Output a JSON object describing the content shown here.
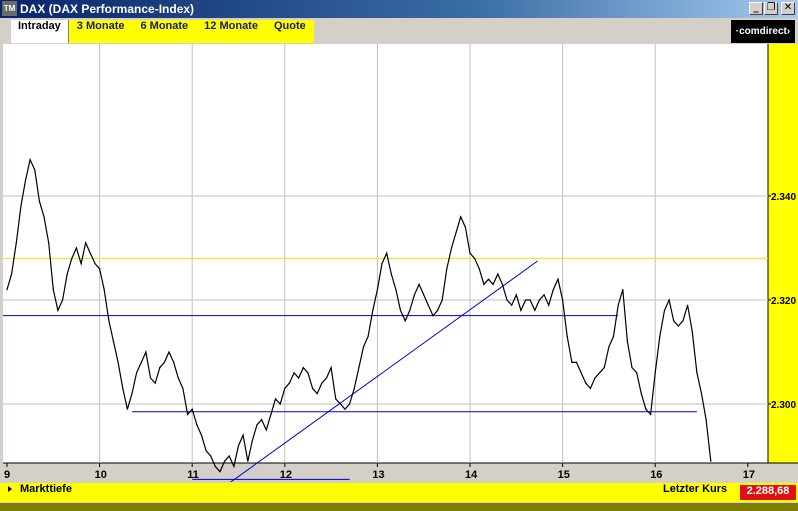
{
  "window": {
    "title": "DAX (DAX Performance-Index)",
    "app_icon_text": "TM",
    "buttons": [
      "_",
      "❐",
      "✕"
    ]
  },
  "tabs": [
    {
      "label": "Intraday",
      "active": true
    },
    {
      "label": "3 Monate",
      "active": false
    },
    {
      "label": "6 Monate",
      "active": false
    },
    {
      "label": "12 Monate",
      "active": false
    },
    {
      "label": "Quote",
      "active": false
    }
  ],
  "logo": "·comdirect›",
  "footer": {
    "left_label": "Markttiefe",
    "last_label": "Letzter Kurs",
    "last_value": "2.288,68"
  },
  "colors": {
    "price_line": "#000000",
    "trend_lines": "#0000cc",
    "yellow_level": "#e8e800",
    "grid": "#c0c0c0",
    "plot_bg": "#ffffff",
    "right_axis_bg": "#ffff00",
    "last_value_bg": "#e01010"
  },
  "chart_data": {
    "type": "line",
    "x_ticks": [
      "9",
      "10",
      "11",
      "12",
      "13",
      "14",
      "15",
      "16",
      "17"
    ],
    "y_ticks": [
      "2.300",
      "2.320",
      "2.340"
    ],
    "xlim": [
      9,
      17.2
    ],
    "ylim": [
      2283,
      2360
    ],
    "grid": true,
    "series": [
      {
        "x": [
          9.0,
          9.05,
          9.1,
          9.15,
          9.2,
          9.25,
          9.3,
          9.35,
          9.4,
          9.45,
          9.5,
          9.55,
          9.6,
          9.65,
          9.7,
          9.75,
          9.8,
          9.85,
          9.9,
          9.95,
          10.0,
          10.05,
          10.1,
          10.15,
          10.2,
          10.25,
          10.3,
          10.35,
          10.4,
          10.45,
          10.5,
          10.55,
          10.6,
          10.65,
          10.7,
          10.75,
          10.8,
          10.85,
          10.9,
          10.95,
          11.0,
          11.05,
          11.1,
          11.15,
          11.2,
          11.25,
          11.3,
          11.35,
          11.4,
          11.45,
          11.5,
          11.55,
          11.6,
          11.65,
          11.7,
          11.75,
          11.8,
          11.85,
          11.9,
          11.95,
          12.0,
          12.05,
          12.1,
          12.15,
          12.2,
          12.25,
          12.3,
          12.35,
          12.4,
          12.45,
          12.5,
          12.55,
          12.6,
          12.65,
          12.7,
          12.75,
          12.8,
          12.85,
          12.9,
          12.95,
          13.0,
          13.05,
          13.1,
          13.15,
          13.2,
          13.25,
          13.3,
          13.35,
          13.4,
          13.45,
          13.5,
          13.55,
          13.6,
          13.65,
          13.7,
          13.75,
          13.8,
          13.85,
          13.9,
          13.95,
          14.0,
          14.05,
          14.1,
          14.15,
          14.2,
          14.25,
          14.3,
          14.35,
          14.4,
          14.45,
          14.5,
          14.55,
          14.6,
          14.65,
          14.7,
          14.75,
          14.8,
          14.85,
          14.9,
          14.95,
          15.0,
          15.05,
          15.1,
          15.15,
          15.2,
          15.25,
          15.3,
          15.35,
          15.4,
          15.45,
          15.5,
          15.55,
          15.6,
          15.65,
          15.7,
          15.75,
          15.8,
          15.85,
          15.9,
          15.95,
          16.0,
          16.05,
          16.1,
          16.15,
          16.2,
          16.25,
          16.3,
          16.35,
          16.4,
          16.45,
          16.5,
          16.55,
          16.6
        ],
        "y": [
          2322,
          2325,
          2331,
          2338,
          2343,
          2347,
          2345,
          2339,
          2336,
          2331,
          2322,
          2318,
          2320,
          2325,
          2328,
          2330,
          2327,
          2331,
          2329,
          2327,
          2326,
          2322,
          2316,
          2312,
          2308,
          2303,
          2299,
          2302,
          2306,
          2308,
          2310,
          2305,
          2304,
          2307,
          2308,
          2310,
          2308,
          2305,
          2303,
          2298,
          2299,
          2296,
          2294,
          2291,
          2290,
          2288,
          2287,
          2289,
          2290,
          2288,
          2292,
          2294,
          2289,
          2293,
          2296,
          2297,
          2295,
          2298,
          2301,
          2300,
          2303,
          2304,
          2306,
          2305,
          2307,
          2306,
          2303,
          2302,
          2304,
          2305,
          2307,
          2301,
          2300,
          2299,
          2300,
          2303,
          2307,
          2311,
          2313,
          2318,
          2322,
          2327,
          2329,
          2325,
          2322,
          2318,
          2316,
          2318,
          2321,
          2323,
          2321,
          2319,
          2317,
          2318,
          2320,
          2326,
          2330,
          2333,
          2336,
          2334,
          2329,
          2328,
          2326,
          2323,
          2324,
          2323,
          2325,
          2323,
          2320,
          2319,
          2321,
          2318,
          2320,
          2320,
          2318,
          2320,
          2321,
          2319,
          2322,
          2324,
          2320,
          2313,
          2308,
          2308,
          2306,
          2304,
          2303,
          2305,
          2306,
          2307,
          2311,
          2313,
          2319,
          2322,
          2312,
          2307,
          2306,
          2302,
          2299,
          2298,
          2306,
          2313,
          2318,
          2320,
          2316,
          2315,
          2316,
          2319,
          2314,
          2306,
          2302,
          2297,
          2289
        ]
      }
    ],
    "horizontal_lines": [
      {
        "y": 2328,
        "color": "yellow",
        "x_start": 9.0,
        "x_end": 17.2
      },
      {
        "y": 2317,
        "color": "blue",
        "x_start": 9.0,
        "x_end": 15.6
      },
      {
        "y": 2298.5,
        "color": "blue",
        "x_start": 10.35,
        "x_end": 16.45
      },
      {
        "y": 2285.5,
        "color": "blue",
        "x_start": 11.0,
        "x_end": 12.7
      }
    ],
    "trend_line": {
      "x": [
        11.3,
        14.73
      ],
      "y": 2283.5,
      "y_end": 2327.5
    }
  }
}
